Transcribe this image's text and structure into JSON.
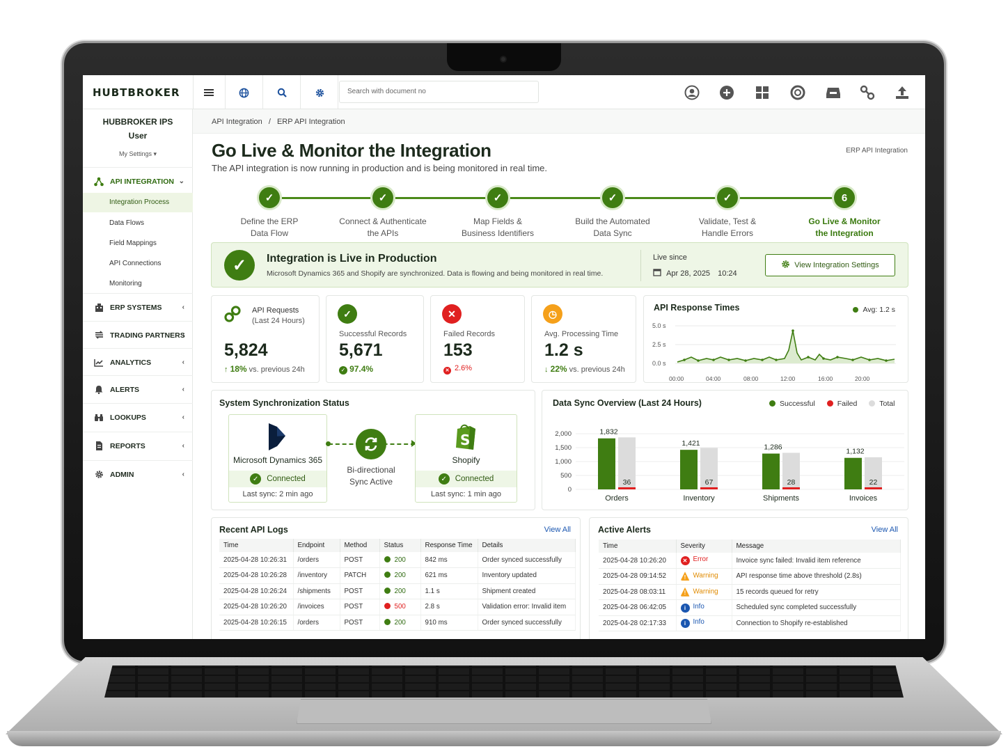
{
  "app": {
    "logo": "HUBTBROKER",
    "search_placeholder": "Search with document no"
  },
  "topbar": {
    "left_icons": [
      "menu-icon",
      "globe-icon",
      "search-icon",
      "gear-icon"
    ],
    "right_icons": [
      "user-circle-icon",
      "plus-circle-icon",
      "grid-icon",
      "lifebuoy-icon",
      "inbox-icon",
      "link-icon",
      "upload-icon"
    ]
  },
  "user": {
    "name_line1": "HUBBROKER IPS",
    "name_line2": "User",
    "settings": "My Settings ▾"
  },
  "sidebar": {
    "api_integration": "API INTEGRATION",
    "sub_items": [
      "Integration Process",
      "Data Flows",
      "Field Mappings",
      "API Connections",
      "Monitoring"
    ],
    "sections": [
      "ERP SYSTEMS",
      "TRADING PARTNERS",
      "ANALYTICS",
      "ALERTS",
      "LOOKUPS",
      "REPORTS",
      "ADMIN"
    ]
  },
  "breadcrumb": {
    "a": "API Integration",
    "sep": "/",
    "b": "ERP API Integration"
  },
  "page": {
    "title": "Go Live & Monitor the Integration",
    "subtitle": "The API integration is now running in production and is being monitored in real time.",
    "context": "ERP API Integration"
  },
  "steps": [
    {
      "num": "✓",
      "l1": "Define the ERP",
      "l2": "Data Flow"
    },
    {
      "num": "✓",
      "l1": "Connect & Authenticate",
      "l2": "the APIs"
    },
    {
      "num": "✓",
      "l1": "Map Fields &",
      "l2": "Business Identifiers"
    },
    {
      "num": "✓",
      "l1": "Build the Automated",
      "l2": "Data Sync"
    },
    {
      "num": "✓",
      "l1": "Validate, Test &",
      "l2": "Handle Errors"
    },
    {
      "num": "6",
      "l1": "Go Live & Monitor",
      "l2": "the Integration"
    }
  ],
  "banner": {
    "title": "Integration is Live in Production",
    "text": "Microsoft Dynamics 365 and Shopify are synchronized. Data is flowing and being monitored in real time.",
    "live_since_label": "Live since",
    "live_date": "Apr 28, 2025",
    "live_time": "10:24",
    "button": "View Integration Settings"
  },
  "kpis": [
    {
      "l1": "API Requests",
      "l2": "(Last 24 Hours)",
      "value": "5,824",
      "change": "18%",
      "change_text": "vs. previous 24h"
    },
    {
      "l1": "Successful Records",
      "value": "5,671",
      "change": "97.4%"
    },
    {
      "l1": "Failed Records",
      "value": "153",
      "change": "2.6%"
    },
    {
      "l1": "Avg. Processing Time",
      "value": "1.2 s",
      "change": "22%",
      "change_text": "vs. previous 24h"
    }
  ],
  "response_chart": {
    "title": "API Response Times",
    "legend": "Avg: 1.2 s",
    "yticks": [
      "5.0 s",
      "2.5 s",
      "0.0 s"
    ],
    "xticks": [
      "00:00",
      "04:00",
      "08:00",
      "12:00",
      "16:00",
      "20:00"
    ]
  },
  "sync_status": {
    "title": "System Synchronization Status",
    "left": {
      "name": "Microsoft Dynamics 365",
      "status": "Connected",
      "last": "Last sync: 2 min ago"
    },
    "middle_l1": "Bi-directional",
    "middle_l2": "Sync Active",
    "right": {
      "name": "Shopify",
      "status": "Connected",
      "last": "Last sync: 1 min ago"
    }
  },
  "chart_data": {
    "type": "bar",
    "title": "Data Sync Overview (Last 24 Hours)",
    "categories": [
      "Orders",
      "Inventory",
      "Shipments",
      "Invoices"
    ],
    "series": [
      {
        "name": "Successful",
        "values": [
          1832,
          1421,
          1286,
          1132
        ],
        "color": "#3f7d12"
      },
      {
        "name": "Failed",
        "values": [
          36,
          67,
          28,
          22
        ],
        "color": "#e02020"
      },
      {
        "name": "Total",
        "values": [
          1868,
          1488,
          1314,
          1154
        ],
        "color": "#dcdcdc"
      }
    ],
    "ylim": [
      0,
      2000
    ],
    "yticks": [
      "2,000",
      "1,500",
      "1,000",
      "500",
      "0"
    ],
    "bar_labels": [
      "1,832",
      "1,421",
      "1,286",
      "1,132"
    ],
    "failed_labels": [
      "36",
      "67",
      "28",
      "22"
    ]
  },
  "logs": {
    "title": "Recent API Logs",
    "view_all": "View All",
    "headers": [
      "Time",
      "Endpoint",
      "Method",
      "Status",
      "Response Time",
      "Details"
    ],
    "rows": [
      [
        "2025-04-28 10:26:31",
        "/orders",
        "POST",
        "200",
        "842 ms",
        "Order synced successfully"
      ],
      [
        "2025-04-28 10:26:28",
        "/inventory",
        "PATCH",
        "200",
        "621 ms",
        "Inventory updated"
      ],
      [
        "2025-04-28 10:26:24",
        "/shipments",
        "POST",
        "200",
        "1.1 s",
        "Shipment created"
      ],
      [
        "2025-04-28 10:26:20",
        "/invoices",
        "POST",
        "500",
        "2.8 s",
        "Validation error: Invalid item"
      ],
      [
        "2025-04-28 10:26:15",
        "/orders",
        "POST",
        "200",
        "910 ms",
        "Order synced successfully"
      ]
    ]
  },
  "alerts": {
    "title": "Active Alerts",
    "view_all": "View All",
    "headers": [
      "Time",
      "Severity",
      "Message"
    ],
    "rows": [
      [
        "2025-04-28 10:26:20",
        "Error",
        "Invoice sync failed: Invalid item reference"
      ],
      [
        "2025-04-28 09:14:52",
        "Warning",
        "API response time above threshold (2.8s)"
      ],
      [
        "2025-04-28 08:03:11",
        "Warning",
        "15 records queued for retry"
      ],
      [
        "2025-04-28 06:42:05",
        "Info",
        "Scheduled sync completed successfully"
      ],
      [
        "2025-04-28 02:17:33",
        "Info",
        "Connection to Shopify re-established"
      ]
    ]
  }
}
